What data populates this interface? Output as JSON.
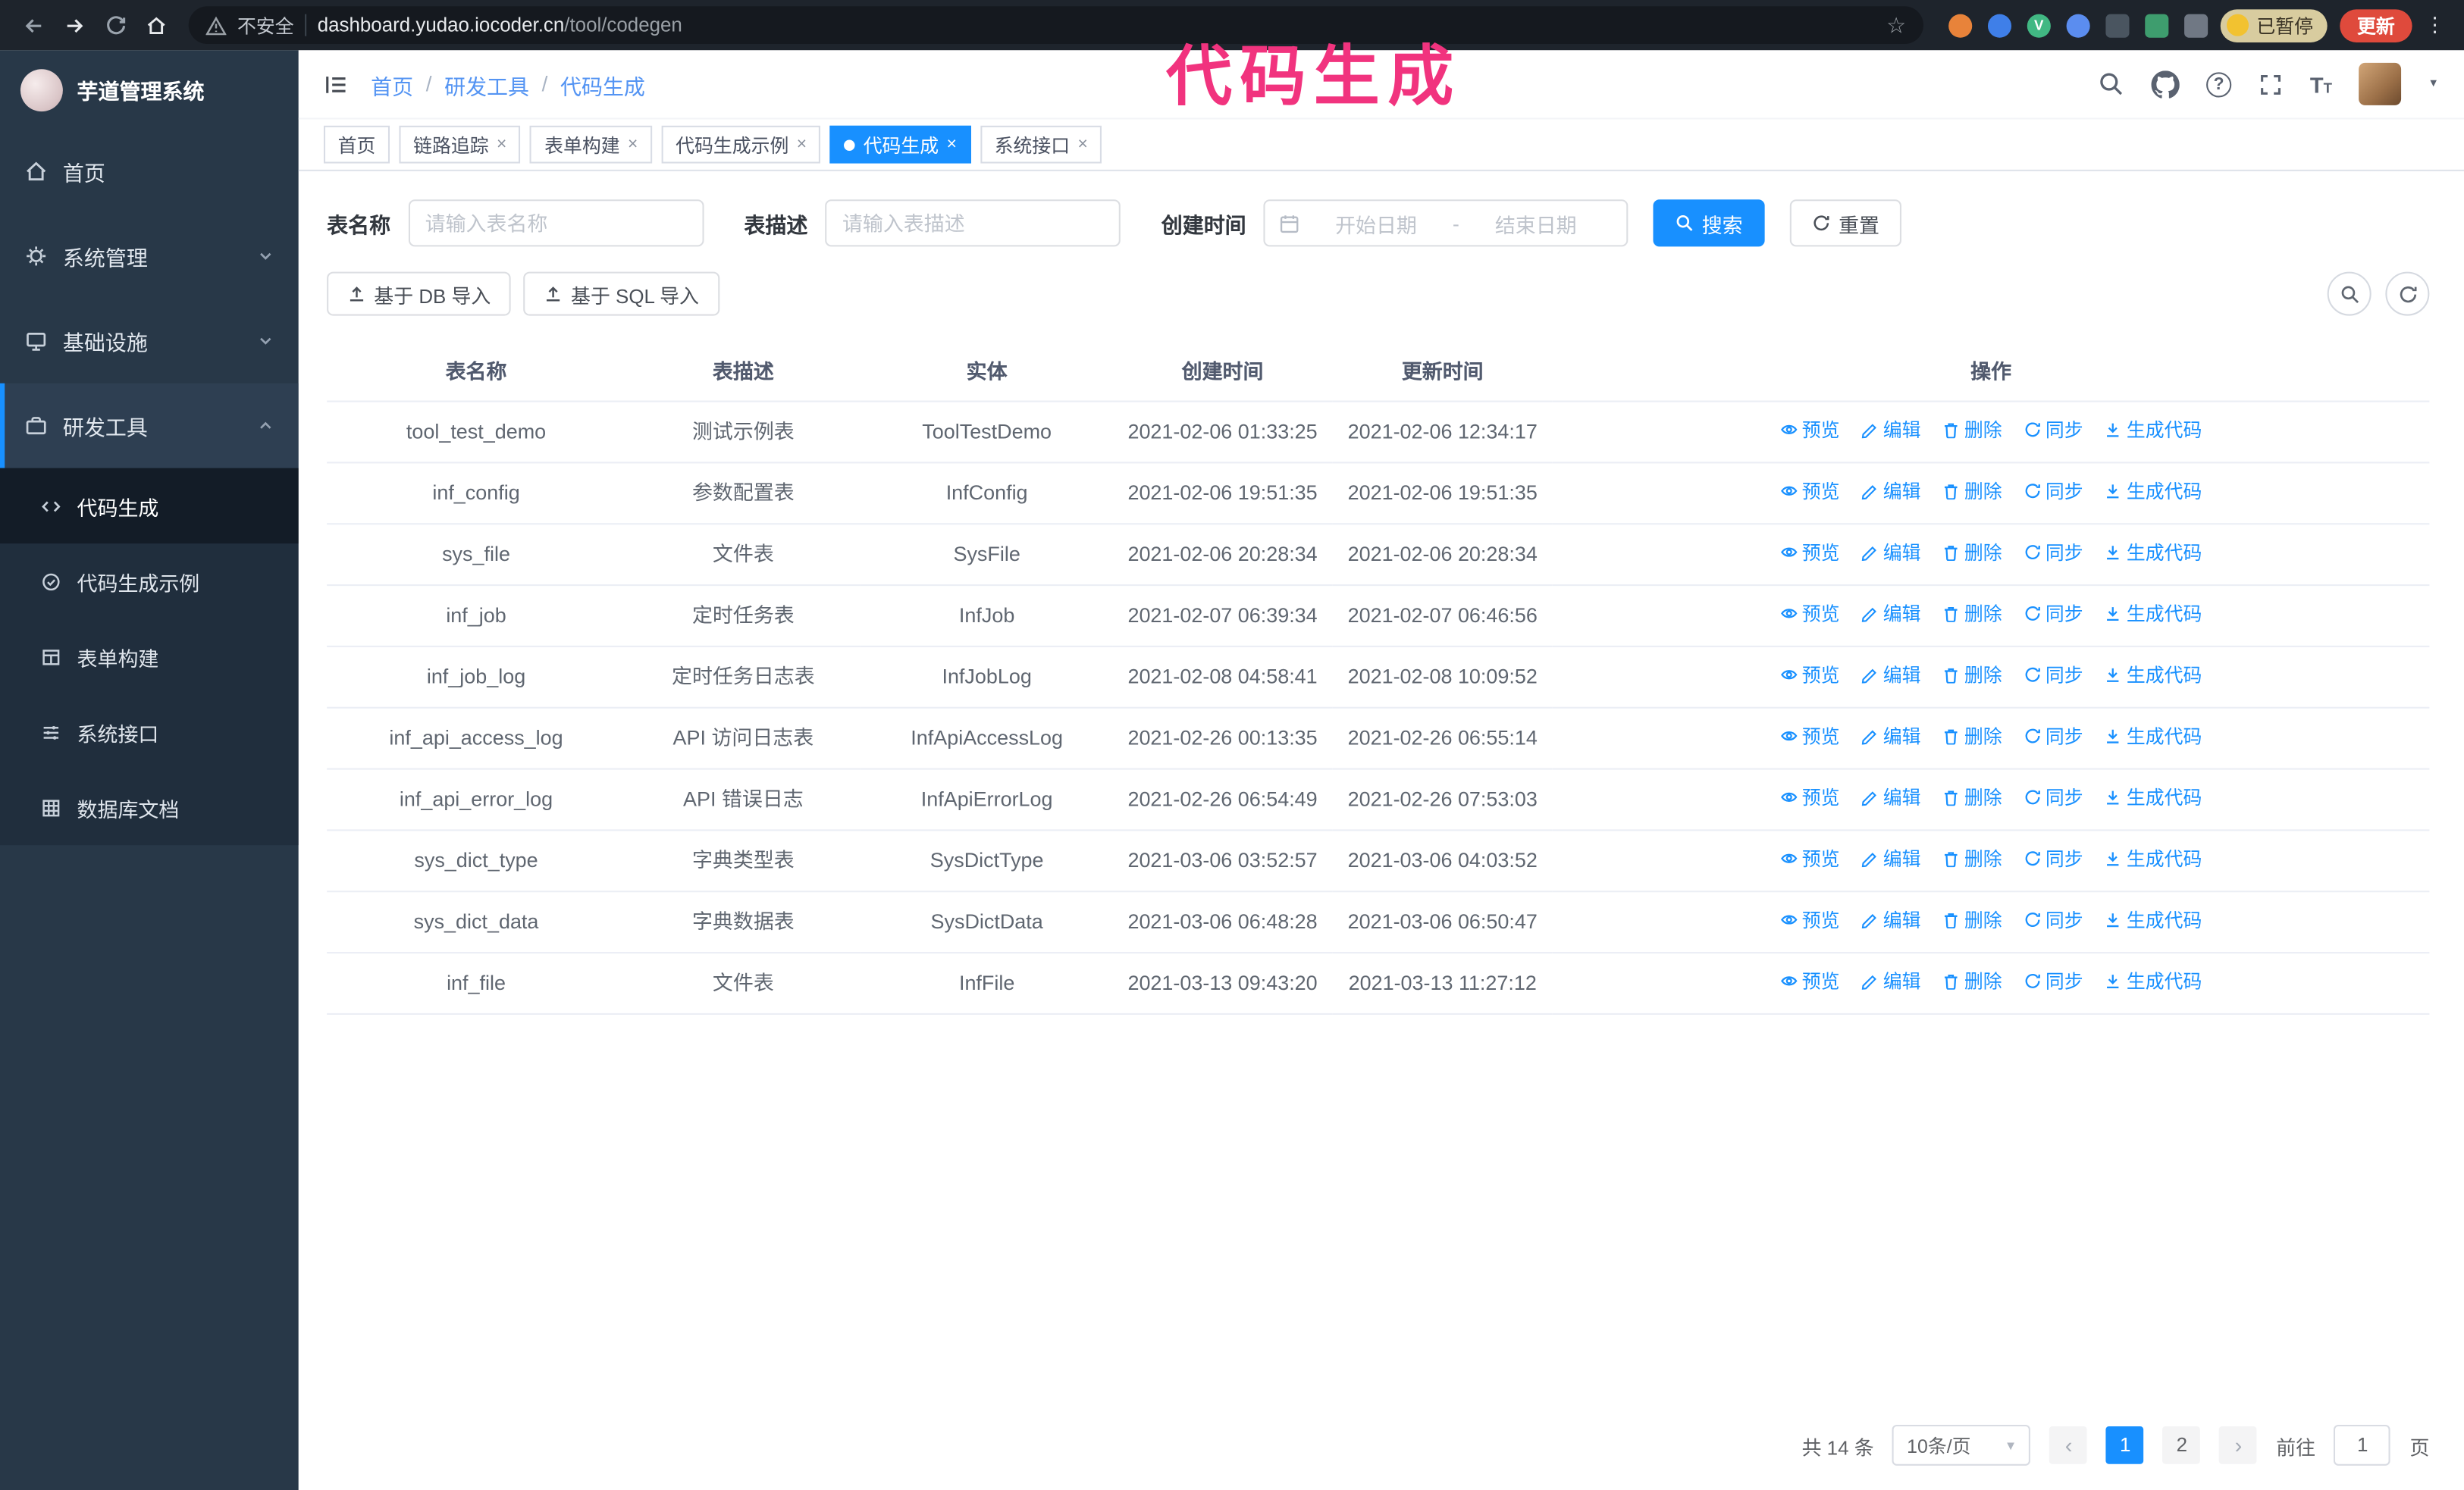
{
  "browser": {
    "security_label": "不安全",
    "url_domain": "dashboard.yudao.iocoder.cn",
    "url_path": "/tool/codegen",
    "paused_badge": "已暂停",
    "update_button": "更新",
    "vue_badge": "V"
  },
  "icons": {
    "star": "☆",
    "caret_down": "▼",
    "kebab": "⋮",
    "question": "?",
    "close": "×",
    "prev": "‹",
    "next": "›",
    "tsize_big": "T",
    "tsize_small": "T"
  },
  "annotation": {
    "text": "代码生成"
  },
  "sidebar": {
    "logo_title": "芋道管理系统",
    "items": [
      {
        "label": "首页"
      },
      {
        "label": "系统管理"
      },
      {
        "label": "基础设施"
      },
      {
        "label": "研发工具"
      }
    ],
    "sub_items": [
      {
        "label": "代码生成"
      },
      {
        "label": "代码生成示例"
      },
      {
        "label": "表单构建"
      },
      {
        "label": "系统接口"
      },
      {
        "label": "数据库文档"
      }
    ]
  },
  "header": {
    "breadcrumb": [
      "首页",
      "研发工具",
      "代码生成"
    ],
    "separator": "/"
  },
  "tabs": [
    {
      "label": "首页"
    },
    {
      "label": "链路追踪"
    },
    {
      "label": "表单构建"
    },
    {
      "label": "代码生成示例"
    },
    {
      "label": "代码生成"
    },
    {
      "label": "系统接口"
    }
  ],
  "filters": {
    "table_name_label": "表名称",
    "table_name_placeholder": "请输入表名称",
    "table_desc_label": "表描述",
    "table_desc_placeholder": "请输入表描述",
    "create_time_label": "创建时间",
    "date_start_placeholder": "开始日期",
    "date_separator": "-",
    "date_end_placeholder": "结束日期",
    "search_button": "搜索",
    "reset_button": "重置"
  },
  "toolbar": {
    "import_db_button": "基于 DB 导入",
    "import_sql_button": "基于 SQL 导入"
  },
  "table": {
    "headers": [
      "表名称",
      "表描述",
      "实体",
      "创建时间",
      "更新时间",
      "操作"
    ],
    "actions": [
      {
        "label": "预览"
      },
      {
        "label": "编辑"
      },
      {
        "label": "删除"
      },
      {
        "label": "同步"
      },
      {
        "label": "生成代码"
      }
    ],
    "rows": [
      {
        "name": "tool_test_demo",
        "desc": "测试示例表",
        "entity": "ToolTestDemo",
        "created": "2021-02-06 01:33:25",
        "updated": "2021-02-06 12:34:17"
      },
      {
        "name": "inf_config",
        "desc": "参数配置表",
        "entity": "InfConfig",
        "created": "2021-02-06 19:51:35",
        "updated": "2021-02-06 19:51:35"
      },
      {
        "name": "sys_file",
        "desc": "文件表",
        "entity": "SysFile",
        "created": "2021-02-06 20:28:34",
        "updated": "2021-02-06 20:28:34"
      },
      {
        "name": "inf_job",
        "desc": "定时任务表",
        "entity": "InfJob",
        "created": "2021-02-07 06:39:34",
        "updated": "2021-02-07 06:46:56"
      },
      {
        "name": "inf_job_log",
        "desc": "定时任务日志表",
        "entity": "InfJobLog",
        "created": "2021-02-08 04:58:41",
        "updated": "2021-02-08 10:09:52"
      },
      {
        "name": "inf_api_access_log",
        "desc": "API 访问日志表",
        "entity": "InfApiAccessLog",
        "created": "2021-02-26 00:13:35",
        "updated": "2021-02-26 06:55:14"
      },
      {
        "name": "inf_api_error_log",
        "desc": "API 错误日志",
        "entity": "InfApiErrorLog",
        "created": "2021-02-26 06:54:49",
        "updated": "2021-02-26 07:53:03"
      },
      {
        "name": "sys_dict_type",
        "desc": "字典类型表",
        "entity": "SysDictType",
        "created": "2021-03-06 03:52:57",
        "updated": "2021-03-06 04:03:52"
      },
      {
        "name": "sys_dict_data",
        "desc": "字典数据表",
        "entity": "SysDictData",
        "created": "2021-03-06 06:48:28",
        "updated": "2021-03-06 06:50:47"
      },
      {
        "name": "inf_file",
        "desc": "文件表",
        "entity": "InfFile",
        "created": "2021-03-13 09:43:20",
        "updated": "2021-03-13 11:27:12"
      }
    ]
  },
  "pagination": {
    "total": "共 14 条",
    "page_size": "10条/页",
    "pages": [
      "1",
      "2"
    ],
    "goto_label": "前往",
    "goto_value": "1",
    "page_suffix": "页"
  },
  "colors": {
    "accent": "#1890ff",
    "annotation_pink": "#f1337e",
    "sidebar_bg": "#283848",
    "update_red": "#df4a3c"
  }
}
